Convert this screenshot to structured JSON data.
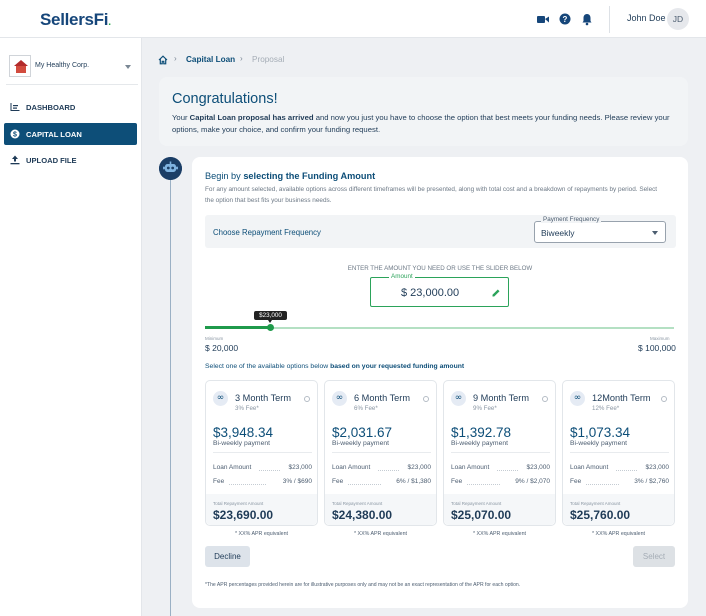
{
  "brand": {
    "logo_text": "SellersFi",
    "logo_dot": "."
  },
  "topbar": {
    "user_name": "John Doe",
    "user_initials": "JD"
  },
  "sidebar": {
    "org_name": "My Healthy Corp.",
    "items": [
      {
        "label": "DASHBOARD",
        "icon": "bar-chart-icon",
        "active": false
      },
      {
        "label": "CAPITAL LOAN",
        "icon": "dollar-circle-icon",
        "active": true
      },
      {
        "label": "UPLOAD FILE",
        "icon": "upload-icon",
        "active": false
      }
    ]
  },
  "breadcrumb": {
    "link": "Capital Loan",
    "current": "Proposal"
  },
  "congrats": {
    "title": "Congratulations!",
    "msg_pre": "Your ",
    "msg_bold": "Capital Loan proposal has arrived",
    "msg_post": " and now you just you have to choose  the option that best meets your funding needs. Please review your options, make your choice, and confirm your funding request."
  },
  "funding": {
    "title_pre": "Begin by ",
    "title_bold": "selecting the Funding Amount",
    "subtitle": "For any amount selected, available options across different timeframes will be presented, along with total cost and a breakdown of repayments by period. Select the option that best fits your business needs.",
    "frequency_label": "Choose Repayment Frequency",
    "frequency_legend": "Payment Frequency",
    "frequency_value": "Biweekly",
    "enter_label": "ENTER THE AMOUNT YOU NEED OR USE THE SLIDER BELOW",
    "amount_legend": "Amount",
    "amount_value": "$ 23,000.00",
    "slider_tooltip": "$23,000",
    "slider_fraction": 0.0375,
    "min_label": "Minimum",
    "min_value": "$ 20,000",
    "max_label": "Maximum",
    "max_value": "$ 100,000",
    "options_hint_pre": "Select one of the available options below ",
    "options_hint_bold": "based on your requested funding amount"
  },
  "options": [
    {
      "name": "3 Month Term",
      "fee": "3% Fee*",
      "payment": "$3,948.34",
      "period": "Bi-weekly payment",
      "loan_label": "Loan Amount",
      "loan_value": "$23,000",
      "fee_label": "Fee",
      "fee_value": "3% / $690",
      "total_label": "Total Repayment Amount",
      "total_value": "$23,690.00",
      "apr": "* XX% APR equivalent"
    },
    {
      "name": "6 Month Term",
      "fee": "6% Fee*",
      "payment": "$2,031.67",
      "period": "Bi-weekly payment",
      "loan_label": "Loan Amount",
      "loan_value": "$23,000",
      "fee_label": "Fee",
      "fee_value": "6% / $1,380",
      "total_label": "Total Repayment Amount",
      "total_value": "$24,380.00",
      "apr": "* XX% APR equivalent"
    },
    {
      "name": "9 Month Term",
      "fee": "9% Fee*",
      "payment": "$1,392.78",
      "period": "Bi-weekly payment",
      "loan_label": "Loan Amount",
      "loan_value": "$23,000",
      "fee_label": "Fee",
      "fee_value": "9% / $2,070",
      "total_label": "Total Repayment Amount",
      "total_value": "$25,070.00",
      "apr": "* XX% APR equivalent"
    },
    {
      "name": "12Month Term",
      "fee": "12% Fee*",
      "payment": "$1,073.34",
      "period": "Bi-weekly payment",
      "loan_label": "Loan Amount",
      "loan_value": "$23,000",
      "fee_label": "Fee",
      "fee_value": "3% / $2,760",
      "total_label": "Total Repayment Amount",
      "total_value": "$25,760.00",
      "apr": "* XX% APR equivalent"
    }
  ],
  "buttons": {
    "decline": "Decline",
    "select": "Select"
  },
  "footnote": "*The APR percentages provided herein are for illustrative purposes only and may not be an exact representation of the APR for each option.",
  "colors": {
    "brand_navy": "#0d4e78",
    "accent_green": "#1f9a4b",
    "sidebar_active": "#0d4e78"
  }
}
